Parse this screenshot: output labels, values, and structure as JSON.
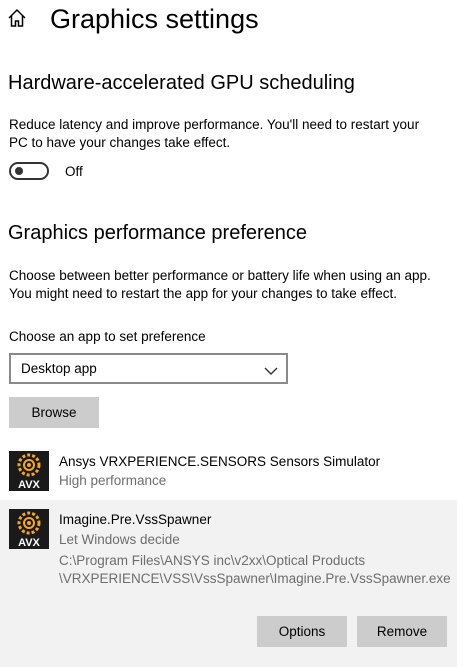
{
  "header": {
    "title": "Graphics settings"
  },
  "gpu_scheduling": {
    "heading": "Hardware-accelerated GPU scheduling",
    "description_line1": "Reduce latency and improve performance. You'll need to restart your",
    "description_line2": "PC to have your changes take effect.",
    "toggle_state": "Off"
  },
  "performance_preference": {
    "heading": "Graphics performance preference",
    "description_line1": "Choose between better performance or battery life when using an app.",
    "description_line2": "You might need to restart the app for your changes to take effect.",
    "choose_label": "Choose an app to set preference",
    "selected_app_type": "Desktop app",
    "browse_label": "Browse"
  },
  "apps": [
    {
      "icon_text": "AVX",
      "name": "Ansys VRXPERIENCE.SENSORS Sensors Simulator",
      "preference": "High performance"
    },
    {
      "icon_text": "AVX",
      "name": "Imagine.Pre.VssSpawner",
      "preference": "Let Windows decide",
      "path_line1": "C:\\Program Files\\ANSYS inc\\v2xx\\Optical Products",
      "path_line2": "\\VRXPERIENCE\\VSS\\VssSpawner\\Imagine.Pre.VssSpawner.exe",
      "options_label": "Options",
      "remove_label": "Remove"
    }
  ],
  "colors": {
    "button_bg": "#cccccc",
    "selected_row_bg": "#f2f2f2",
    "secondary_text": "#6d6d6d",
    "app_icon_bg": "#1a1a1a",
    "app_icon_accent": "#f5a623"
  }
}
